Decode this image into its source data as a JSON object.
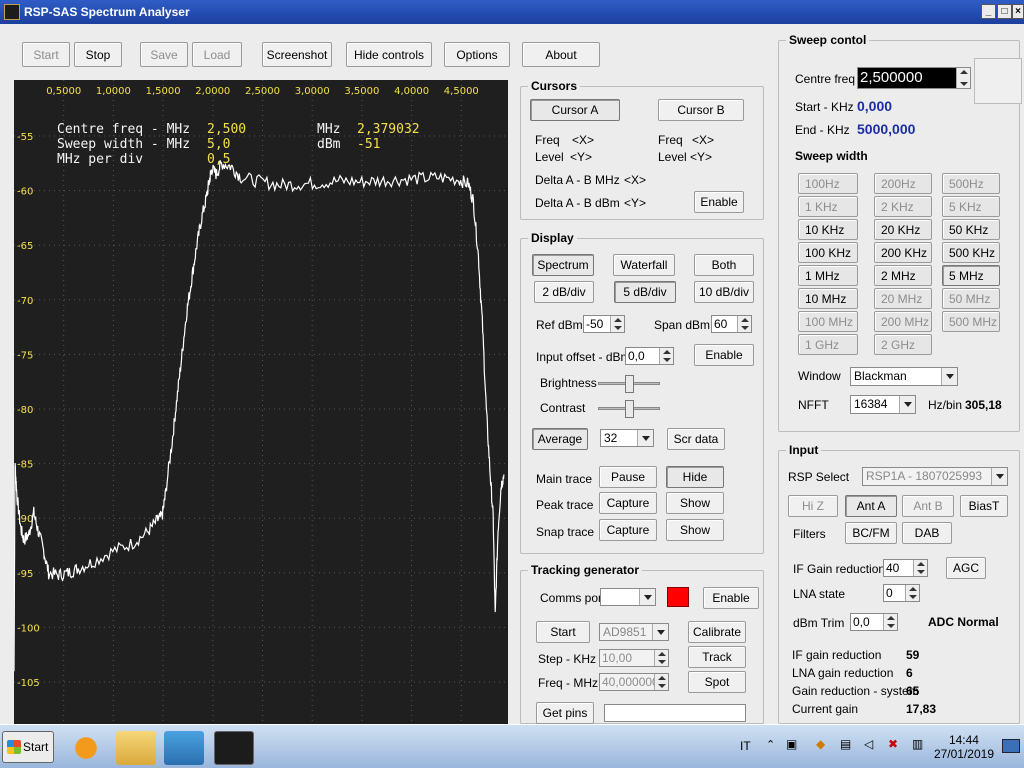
{
  "window": {
    "title": "RSP-SAS Spectrum Analyser"
  },
  "toolbar": {
    "start": "Start",
    "stop": "Stop",
    "save": "Save",
    "load": "Load",
    "screenshot": "Screenshot",
    "hide_controls": "Hide controls",
    "options": "Options",
    "about": "About"
  },
  "scope": {
    "centre_freq_label": "Centre freq - MHz",
    "centre_freq_value": "2,500",
    "sweep_width_label": "Sweep width - MHz",
    "sweep_width_value": "5,0",
    "mhz_per_div_label": "MHz per div",
    "mhz_per_div_value": "0,5",
    "cursor_mhz_label": "MHz",
    "cursor_mhz_value": "2,379032",
    "cursor_dbm_label": "dBm",
    "cursor_dbm_value": "-51",
    "x_ticks": [
      "0,5000",
      "1,0000",
      "1,5000",
      "2,0000",
      "2,5000",
      "3,0000",
      "3,5000",
      "4,0000",
      "4,5000"
    ],
    "y_ticks": [
      "-55",
      "-60",
      "-65",
      "-70",
      "-75",
      "-80",
      "-85",
      "-90",
      "-95",
      "-100",
      "-105"
    ],
    "colors": {
      "background": "#1f1f1f",
      "grid": "#555555",
      "text": "#f5f5f5",
      "values": "#f4e04a",
      "axis_labels": "#f4e04a",
      "trace": "#ffffff"
    }
  },
  "cursors": {
    "title": "Cursors",
    "cursor_a": "Cursor A",
    "cursor_b": "Cursor B",
    "freq_label": "Freq",
    "freq_a": "<X>",
    "freq_b": "<X>",
    "level_label": "Level",
    "level_a": "<Y>",
    "level_b": "<Y>",
    "delta_mhz_label": "Delta A - B MHz",
    "delta_mhz": "<X>",
    "delta_dbm_label": "Delta A - B dBm",
    "delta_dbm": "<Y>",
    "enable": "Enable"
  },
  "display": {
    "title": "Display",
    "spectrum": "Spectrum",
    "waterfall": "Waterfall",
    "both": "Both",
    "db2": "2 dB/div",
    "db5": "5 dB/div",
    "db10": "10 dB/div",
    "ref_dbm_label": "Ref dBm",
    "ref_dbm": "-50",
    "span_dbm_label": "Span dBm",
    "span_dbm": "60",
    "input_offset_label": "Input offset - dBm",
    "input_offset": "0,0",
    "enable": "Enable",
    "brightness": "Brightness",
    "contrast": "Contrast",
    "average": "Average",
    "average_value": "32",
    "scr_data": "Scr data",
    "main_trace": "Main trace",
    "pause": "Pause",
    "hide": "Hide",
    "peak_trace": "Peak trace",
    "snap_trace": "Snap trace",
    "capture": "Capture",
    "show": "Show"
  },
  "tracking": {
    "title": "Tracking generator",
    "comms_port": "Comms port",
    "comms_value": "",
    "enable": "Enable",
    "start": "Start",
    "chip": "AD9851",
    "calibrate": "Calibrate",
    "step_label": "Step - KHz",
    "step": "10,00",
    "track": "Track",
    "freq_label": "Freq - MHz",
    "freq": "40,000000",
    "spot": "Spot",
    "get_pins": "Get pins",
    "pins_value": "",
    "indicator_color": "#ff0000"
  },
  "sweep": {
    "title": "Sweep contol",
    "centre_freq_label": "Centre freq",
    "centre_freq": "2,500000",
    "start_label": "Start - KHz",
    "start_value": "0,000",
    "end_label": "End - KHz",
    "end_value": "5000,000",
    "sweep_width_label": "Sweep width",
    "widths": [
      "100Hz",
      "200Hz",
      "500Hz",
      "1 KHz",
      "2 KHz",
      "5 KHz",
      "10 KHz",
      "20 KHz",
      "50 KHz",
      "100 KHz",
      "200 KHz",
      "500 KHz",
      "1 MHz",
      "2 MHz",
      "5 MHz",
      "10 MHz",
      "20 MHz",
      "50 MHz",
      "100 MHz",
      "200 MHz",
      "500 MHz",
      "1 GHz",
      "2 GHz"
    ],
    "window_label": "Window",
    "window_value": "Blackman",
    "nfft_label": "NFFT",
    "nfft_value": "16384",
    "hzbin_label": "Hz/bin",
    "hzbin_value": "305,18"
  },
  "input": {
    "title": "Input",
    "rsp_select_label": "RSP Select",
    "rsp_select_value": "RSP1A - 1807025993",
    "hiz": "Hi Z",
    "ant_a": "Ant A",
    "ant_b": "Ant B",
    "bias_t": "BiasT",
    "filters_label": "Filters",
    "bcfm": "BC/FM",
    "dab": "DAB",
    "if_gain_label": "IF Gain reduction",
    "if_gain": "40",
    "agc": "AGC",
    "lna_label": "LNA state",
    "lna": "0",
    "dbm_trim_label": "dBm Trim",
    "dbm_trim": "0,0",
    "adc_status": "ADC Normal",
    "if_gain_red_label": "IF gain reduction",
    "if_gain_red": "59",
    "lna_gain_red_label": "LNA gain reduction",
    "lna_gain_red": "6",
    "gain_red_sys_label": "Gain reduction - system",
    "gain_red_sys": "65",
    "current_gain_label": "Current gain",
    "current_gain": "17,83"
  },
  "taskbar": {
    "start": "Start",
    "lang": "IT",
    "time": "14:44",
    "date": "27/01/2019"
  }
}
